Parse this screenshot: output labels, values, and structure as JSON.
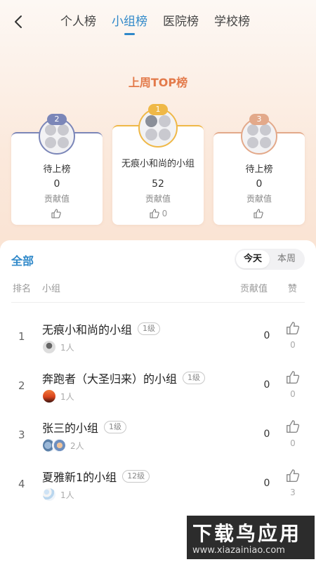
{
  "header": {
    "tabs": [
      {
        "label": "个人榜",
        "active": false
      },
      {
        "label": "小组榜",
        "active": true
      },
      {
        "label": "医院榜",
        "active": false
      },
      {
        "label": "学校榜",
        "active": false
      }
    ]
  },
  "top": {
    "title": "上周TOP榜",
    "podium": [
      {
        "rank": "2",
        "name": "待上榜",
        "value": "0",
        "value_label": "贡献值",
        "likes": "",
        "color": "#7b86b8"
      },
      {
        "rank": "1",
        "name": "无痕小和尚的小组",
        "value": "52",
        "value_label": "贡献值",
        "likes": "0",
        "color": "#efb847"
      },
      {
        "rank": "3",
        "name": "待上榜",
        "value": "0",
        "value_label": "贡献值",
        "likes": "",
        "color": "#e3a98a"
      }
    ]
  },
  "list": {
    "filter_label": "全部",
    "period_tabs": [
      {
        "label": "今天",
        "active": true
      },
      {
        "label": "本周",
        "active": false
      }
    ],
    "columns": {
      "rank": "排名",
      "group": "小组",
      "value": "贡献值",
      "likes": "赞"
    },
    "rows": [
      {
        "rank": "1",
        "name": "无痕小和尚的小组",
        "level": "1级",
        "members": "1人",
        "score": "0",
        "likes": "0"
      },
      {
        "rank": "2",
        "name": "奔跑者（大圣归来）的小组",
        "level": "1级",
        "members": "1人",
        "score": "0",
        "likes": "0"
      },
      {
        "rank": "3",
        "name": "张三的小组",
        "level": "1级",
        "members": "2人",
        "score": "0",
        "likes": "0"
      },
      {
        "rank": "4",
        "name": "夏雅新1的小组",
        "level": "12级",
        "members": "1人",
        "score": "0",
        "likes": "3"
      }
    ]
  },
  "watermark": {
    "main": "下载鸟应用",
    "sub": "www.xiazainiao.com"
  },
  "colors": {
    "accent": "#2f88c9",
    "top_title": "#e37a4a"
  }
}
